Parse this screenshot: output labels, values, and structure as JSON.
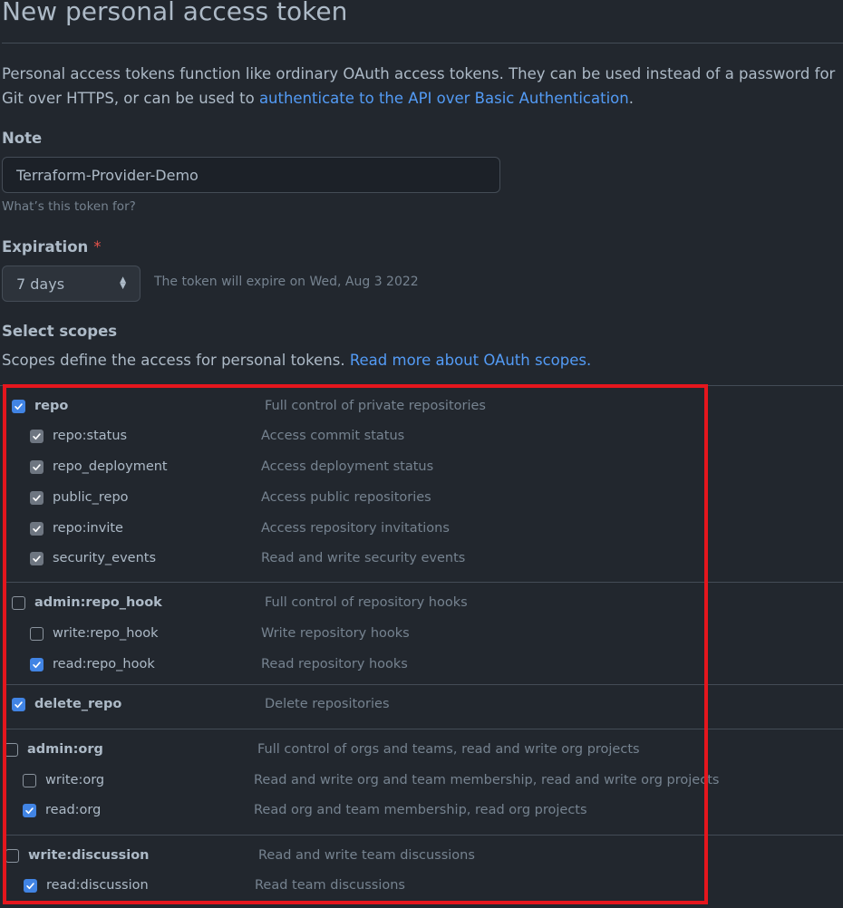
{
  "page": {
    "title": "New personal access token",
    "intro_text": "Personal access tokens function like ordinary OAuth access tokens. They can be used instead of a password for Git over HTTPS, or can be used to",
    "intro_link": "authenticate to the API over Basic Authentication",
    "intro_end": "."
  },
  "note": {
    "label": "Note",
    "value": "Terraform-Provider-Demo",
    "hint": "What’s this token for?"
  },
  "expiration": {
    "label": "Expiration",
    "required_mark": "*",
    "selected": "7 days",
    "note": "The token will expire on Wed, Aug 3 2022"
  },
  "scopes": {
    "heading": "Select scopes",
    "desc_text": "Scopes define the access for personal tokens.",
    "desc_link": "Read more about OAuth scopes.",
    "rows": [
      {
        "name": "repo",
        "desc": "Full control of private repositories",
        "checked": true,
        "parent": true
      },
      {
        "name": "repo:status",
        "desc": "Access commit status",
        "checked": true,
        "parent": false,
        "inherited": true
      },
      {
        "name": "repo_deployment",
        "desc": "Access deployment status",
        "checked": true,
        "parent": false,
        "inherited": true
      },
      {
        "name": "public_repo",
        "desc": "Access public repositories",
        "checked": true,
        "parent": false,
        "inherited": true
      },
      {
        "name": "repo:invite",
        "desc": "Access repository invitations",
        "checked": true,
        "parent": false,
        "inherited": true
      },
      {
        "name": "security_events",
        "desc": "Read and write security events",
        "checked": true,
        "parent": false,
        "inherited": true
      },
      {
        "name": "admin:repo_hook",
        "desc": "Full control of repository hooks",
        "checked": false,
        "parent": true
      },
      {
        "name": "write:repo_hook",
        "desc": "Write repository hooks",
        "checked": false,
        "parent": false
      },
      {
        "name": "read:repo_hook",
        "desc": "Read repository hooks",
        "checked": true,
        "parent": false
      },
      {
        "name": "delete_repo",
        "desc": "Delete repositories",
        "checked": true,
        "parent": true
      },
      {
        "name": "admin:org",
        "desc": "Full control of orgs and teams, read and write org projects",
        "checked": false,
        "parent": true
      },
      {
        "name": "write:org",
        "desc": "Read and write org and team membership, read and write org projects",
        "checked": false,
        "parent": false
      },
      {
        "name": "read:org",
        "desc": "Read org and team membership, read org projects",
        "checked": true,
        "parent": false
      },
      {
        "name": "write:discussion",
        "desc": "Read and write team discussions",
        "checked": false,
        "parent": true
      },
      {
        "name": "read:discussion",
        "desc": "Read team discussions",
        "checked": true,
        "parent": false
      }
    ]
  },
  "colors": {
    "background": "#22272e",
    "link": "#539bf5",
    "highlight_box": "#e5161d",
    "checkbox_checked": "#4184e4"
  }
}
